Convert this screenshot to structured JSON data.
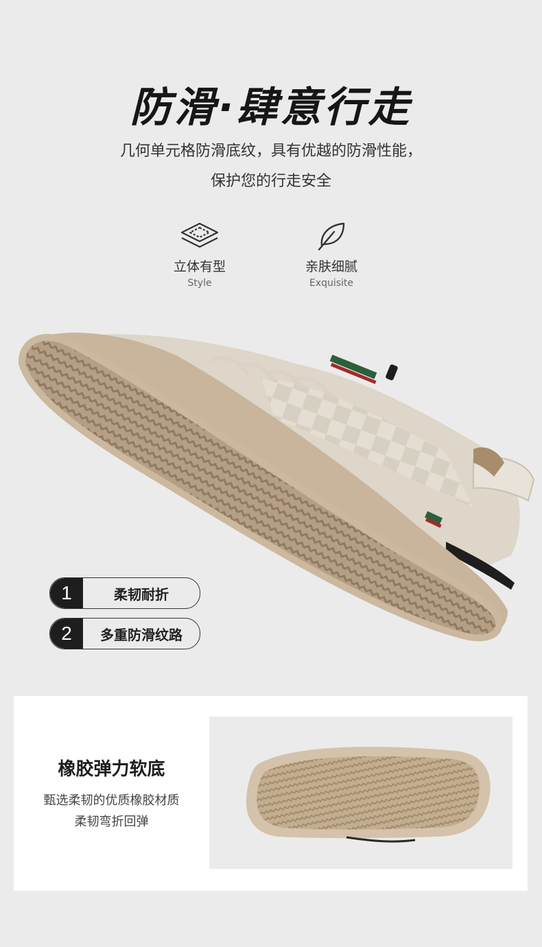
{
  "headline": "防滑·肆意行走",
  "description": {
    "line1": "几何单元格防滑底纹，具有优越的防滑性能，",
    "line2": "保护您的行走安全"
  },
  "features": [
    {
      "icon": "layers-icon",
      "cn": "立体有型",
      "en": "Style"
    },
    {
      "icon": "leaf-icon",
      "cn": "亲肤细腻",
      "en": "Exquisite"
    }
  ],
  "tags": [
    {
      "num": "1",
      "label": "柔韧耐折"
    },
    {
      "num": "2",
      "label": "多重防滑纹路"
    }
  ],
  "panel": {
    "title": "橡胶弹力软底",
    "desc_line1": "甄选柔韧的优质橡胶材质",
    "desc_line2": "柔韧弯折回弹"
  },
  "colors": {
    "background": "#ebebeb",
    "sole": "#c8b59c",
    "shoe_upper": "#ddd6c9",
    "accent_dark": "#1e1e1e"
  }
}
